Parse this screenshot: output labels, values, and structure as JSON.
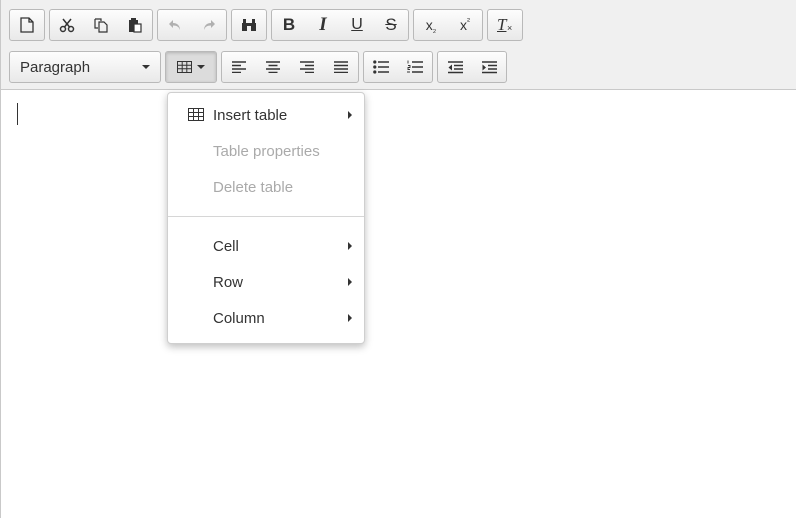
{
  "toolbar": {
    "row1": {
      "new_document": "new-document-icon",
      "cut": "scissors-icon",
      "copy": "copy-icon",
      "paste": "paste-icon",
      "undo": "undo-icon",
      "redo": "redo-icon",
      "find": "binoculars-icon",
      "bold_label": "B",
      "italic_label": "I",
      "underline_label": "U",
      "strike_label": "S",
      "subscript_label": "x",
      "subscript_sub": "₂",
      "superscript_label": "x",
      "superscript_sup": "²",
      "clear_format_label": "T"
    },
    "row2": {
      "format_select_value": "Paragraph",
      "table_button": "table-icon"
    }
  },
  "table_menu": {
    "insert_table": "Insert table",
    "table_properties": "Table properties",
    "delete_table": "Delete table",
    "cell": "Cell",
    "row": "Row",
    "column": "Column"
  },
  "colors": {
    "toolbar_bg": "#f0f0f0",
    "disabled_text": "#aaaaaa",
    "text": "#333333"
  }
}
